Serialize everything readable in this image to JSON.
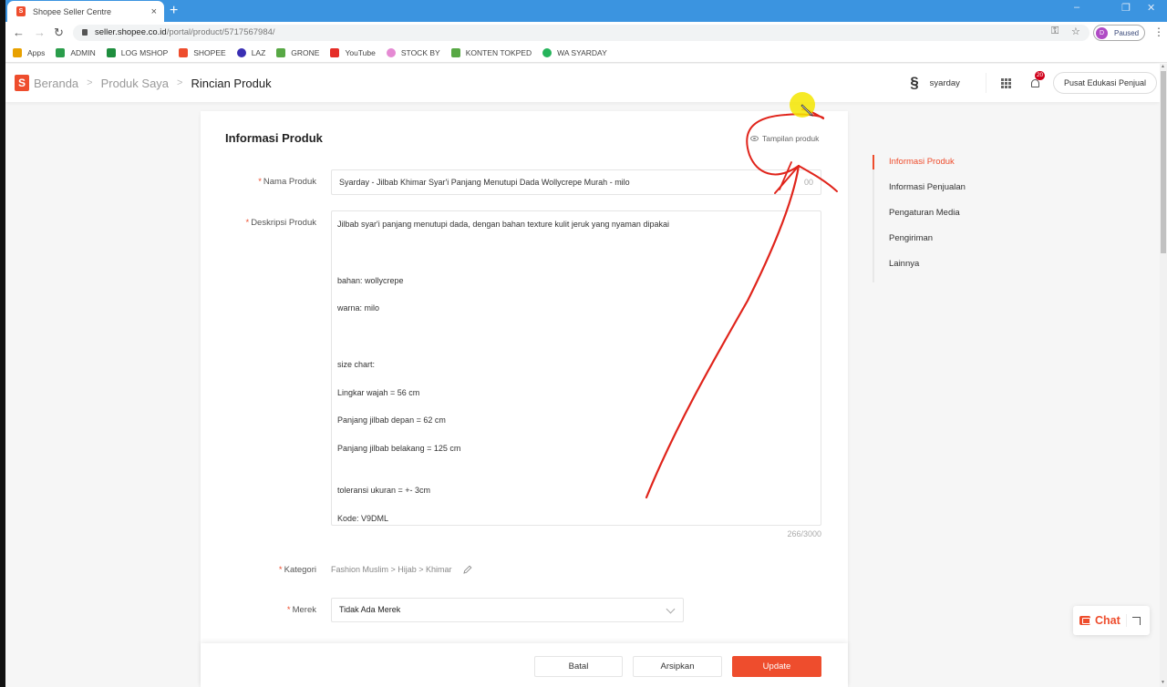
{
  "browser": {
    "tab_title": "Shopee Seller Centre",
    "tab_close": "×",
    "new_tab": "+",
    "url_host": "seller.shopee.co.id",
    "url_path": "/portal/product/5717567984/",
    "profile_initial": "D",
    "profile_status": "Paused",
    "window_controls": [
      "–",
      "❐",
      "✕"
    ],
    "bookmarks": [
      {
        "label": "Apps",
        "icon": "apps-grid-icon",
        "color": "#e8a100"
      },
      {
        "label": "ADMIN",
        "icon": "google-drive-icon",
        "color": "#2a9d4b"
      },
      {
        "label": "LOG MSHOP",
        "icon": "google-sheets-icon",
        "color": "#1e8e3e"
      },
      {
        "label": "SHOPEE",
        "icon": "shopee-icon",
        "color": "#ee4d2d"
      },
      {
        "label": "LAZ",
        "icon": "lazada-heart-icon",
        "color": "#3a2fb3"
      },
      {
        "label": "GRONE",
        "icon": "tokopedia-bag-icon",
        "color": "#58a845"
      },
      {
        "label": "YouTube",
        "icon": "youtube-icon",
        "color": "#e52d27"
      },
      {
        "label": "STOCK BY",
        "icon": "stock-circle-icon",
        "color": "#e58ad3"
      },
      {
        "label": "KONTEN TOKPED",
        "icon": "tokopedia-bag-icon",
        "color": "#58a845"
      },
      {
        "label": "WA SYARDAY",
        "icon": "whatsapp-icon",
        "color": "#25b35a"
      }
    ]
  },
  "header": {
    "logo_letter": "S",
    "breadcrumb": [
      "Beranda",
      "Produk Saya",
      "Rincian Produk"
    ],
    "breadcrumb_sep": ">",
    "username": "syarday",
    "notification_count": "20",
    "edu_button": "Pusat Edukasi Penjual"
  },
  "form": {
    "section_title": "Informasi Produk",
    "preview_link": "Tampilan produk",
    "required_mark": "*",
    "name_label": "Nama Produk",
    "name_value": "Syarday - Jilbab Khimar Syar'i Panjang Menutupi Dada Wollycrepe Murah - milo",
    "name_counter_visible": "00",
    "desc_label": "Deskripsi Produk",
    "desc_lines": [
      "Jilbab syar'i panjang menutupi dada, dengan bahan texture kulit jeruk yang nyaman dipakai",
      "",
      "",
      "",
      "bahan: wollycrepe",
      "",
      "warna: milo",
      "",
      "",
      "",
      "size chart:",
      "",
      "Lingkar wajah = 56 cm",
      "",
      "Panjang jilbab depan = 62 cm",
      "",
      "Panjang jilbab belakang = 125 cm",
      "",
      "",
      "toleransi ukuran = +- 3cm",
      "",
      "Kode: V9DML"
    ],
    "desc_counter": "266/3000",
    "category_label": "Kategori",
    "category_value": "Fashion Muslim > Hijab > Khimar",
    "brand_label": "Merek",
    "brand_value": "Tidak Ada Merek"
  },
  "actions": {
    "cancel": "Batal",
    "archive": "Arsipkan",
    "update": "Update"
  },
  "side_nav": {
    "items": [
      {
        "label": "Informasi Produk",
        "active": true
      },
      {
        "label": "Informasi Penjualan",
        "active": false
      },
      {
        "label": "Pengaturan Media",
        "active": false
      },
      {
        "label": "Pengiriman",
        "active": false
      },
      {
        "label": "Lainnya",
        "active": false
      }
    ]
  },
  "chat": {
    "label": "Chat"
  },
  "colors": {
    "brand": "#ee4d2d",
    "browser_tabbar": "#3b94e0",
    "annotation_ink": "#e0241b",
    "cursor_highlight": "#f5e600"
  }
}
